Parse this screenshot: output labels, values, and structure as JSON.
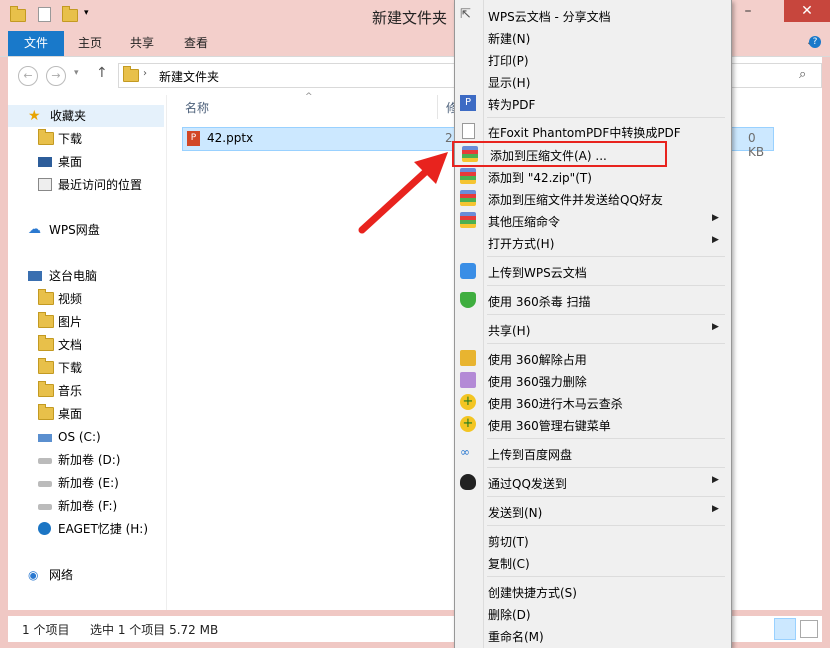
{
  "window": {
    "title": "新建文件夹"
  },
  "ribbon": {
    "tabs": [
      "文件",
      "主页",
      "共享",
      "查看"
    ]
  },
  "address": {
    "path": "新建文件夹"
  },
  "nav": {
    "favorites": "收藏夹",
    "fav_items": [
      "下载",
      "桌面",
      "最近访问的位置"
    ],
    "wps": "WPS网盘",
    "pc": "这台电脑",
    "pc_items": [
      "视频",
      "图片",
      "文档",
      "下载",
      "音乐",
      "桌面",
      "OS (C:)",
      "新加卷 (D:)",
      "新加卷 (E:)",
      "新加卷 (F:)",
      "EAGET忆捷 (H:)"
    ],
    "network": "网络"
  },
  "content": {
    "col_name": "名称",
    "col_partial": "修",
    "file": {
      "name": "42.pptx",
      "date_partial": "2",
      "size_partial": "0 KB"
    }
  },
  "status": {
    "count": "1 个项目",
    "selected": "选中 1 个项目  5.72 MB"
  },
  "menu": {
    "items": [
      "WPS云文档 - 分享文档",
      "新建(N)",
      "打印(P)",
      "显示(H)",
      "转为PDF",
      "在Foxit PhantomPDF中转换成PDF",
      "添加到压缩文件(A) ...",
      "添加到 \"42.zip\"(T)",
      "添加到压缩文件并发送给QQ好友",
      "其他压缩命令",
      "打开方式(H)",
      "上传到WPS云文档",
      "使用 360杀毒 扫描",
      "共享(H)",
      "使用 360解除占用",
      "使用 360强力删除",
      "使用 360进行木马云查杀",
      "使用 360管理右键菜单",
      "上传到百度网盘",
      "通过QQ发送到",
      "发送到(N)",
      "剪切(T)",
      "复制(C)",
      "创建快捷方式(S)",
      "删除(D)",
      "重命名(M)"
    ]
  },
  "colors": {
    "accent": "#1979ca",
    "highlight": "#e8231e",
    "selection": "#cce8ff"
  }
}
